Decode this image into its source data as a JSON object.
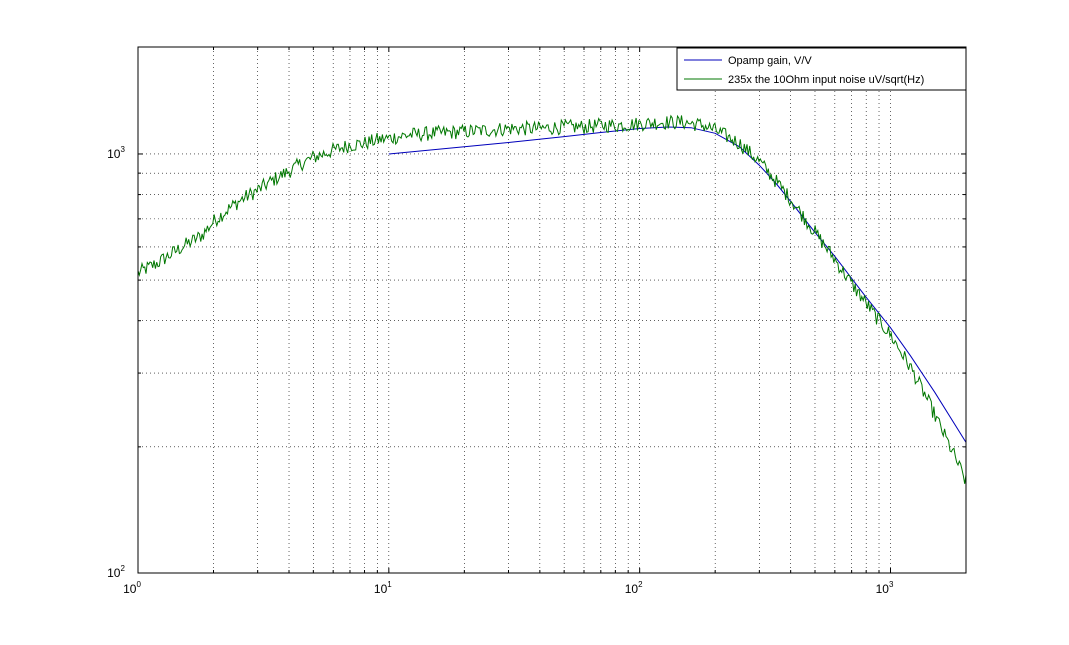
{
  "chart_data": {
    "type": "line",
    "x_scale": "log",
    "y_scale": "log",
    "xlim": [
      1,
      2000
    ],
    "ylim": [
      100,
      1800
    ],
    "grid": true,
    "legend_placement": "top-right",
    "x_ticks": [
      {
        "base": "10",
        "exp": "0"
      },
      {
        "base": "10",
        "exp": "1"
      },
      {
        "base": "10",
        "exp": "2"
      },
      {
        "base": "10",
        "exp": "3"
      }
    ],
    "y_ticks": [
      {
        "base": "10",
        "exp": "2"
      },
      {
        "base": "10",
        "exp": "3"
      }
    ],
    "series": [
      {
        "name": "Opamp gain, V/V",
        "color": "#0000bb",
        "x": [
          10,
          20,
          30,
          50,
          70,
          100,
          130,
          160,
          200,
          250,
          300,
          350,
          400,
          500,
          600,
          700,
          800,
          1000,
          1200,
          1500,
          2000
        ],
        "y": [
          1000,
          1040,
          1065,
          1100,
          1125,
          1150,
          1160,
          1155,
          1120,
          1040,
          940,
          850,
          770,
          650,
          570,
          505,
          455,
          385,
          330,
          270,
          205
        ]
      },
      {
        "name": "235x the 10Ohm input noise uV/sqrt(Hz)",
        "color": "#007700",
        "x": [
          1,
          1.2,
          1.5,
          1.8,
          2,
          2.3,
          2.6,
          3,
          3.5,
          4,
          4.5,
          5,
          6,
          7,
          8,
          9,
          10,
          12,
          15,
          20,
          25,
          30,
          40,
          50,
          60,
          70,
          80,
          100,
          120,
          150,
          180,
          200,
          250,
          300,
          350,
          400,
          500,
          600,
          700,
          800,
          900,
          1000,
          1200,
          1400,
          1600,
          1800,
          2000
        ],
        "y": [
          520,
          550,
          600,
          640,
          690,
          740,
          780,
          820,
          870,
          910,
          950,
          980,
          1020,
          1050,
          1060,
          1080,
          1090,
          1110,
          1120,
          1130,
          1140,
          1150,
          1150,
          1160,
          1160,
          1170,
          1170,
          1180,
          1190,
          1190,
          1170,
          1140,
          1060,
          960,
          860,
          780,
          650,
          560,
          490,
          440,
          400,
          370,
          310,
          260,
          220,
          190,
          165
        ]
      }
    ]
  }
}
